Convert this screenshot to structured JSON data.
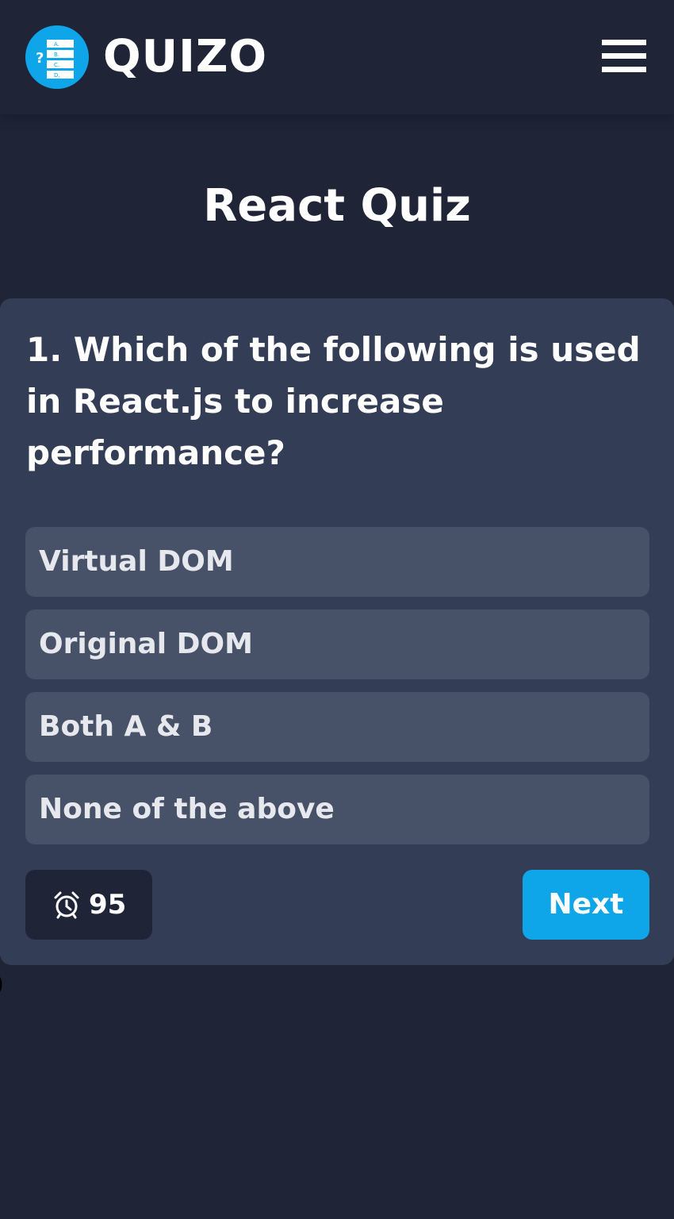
{
  "header": {
    "brand": "QUIZO",
    "logo_icon": "quiz-list-icon",
    "logo_marks": [
      "?",
      "A.",
      "B.",
      "C.",
      "D."
    ],
    "menu_icon": "hamburger-menu-icon"
  },
  "quiz": {
    "title": "React Quiz",
    "question": "1. Which of the following is used in React.js to increase performance?",
    "options": [
      {
        "label": "Virtual DOM"
      },
      {
        "label": "Original DOM"
      },
      {
        "label": "Both A & B"
      },
      {
        "label": "None of the above"
      }
    ],
    "timer": {
      "icon": "alarm-clock-icon",
      "value": "95"
    },
    "next_label": "Next"
  },
  "stray_text": ")",
  "colors": {
    "background": "#1f2537",
    "card": "#333d56",
    "option": "#475269",
    "accent": "#0ea5e9"
  }
}
